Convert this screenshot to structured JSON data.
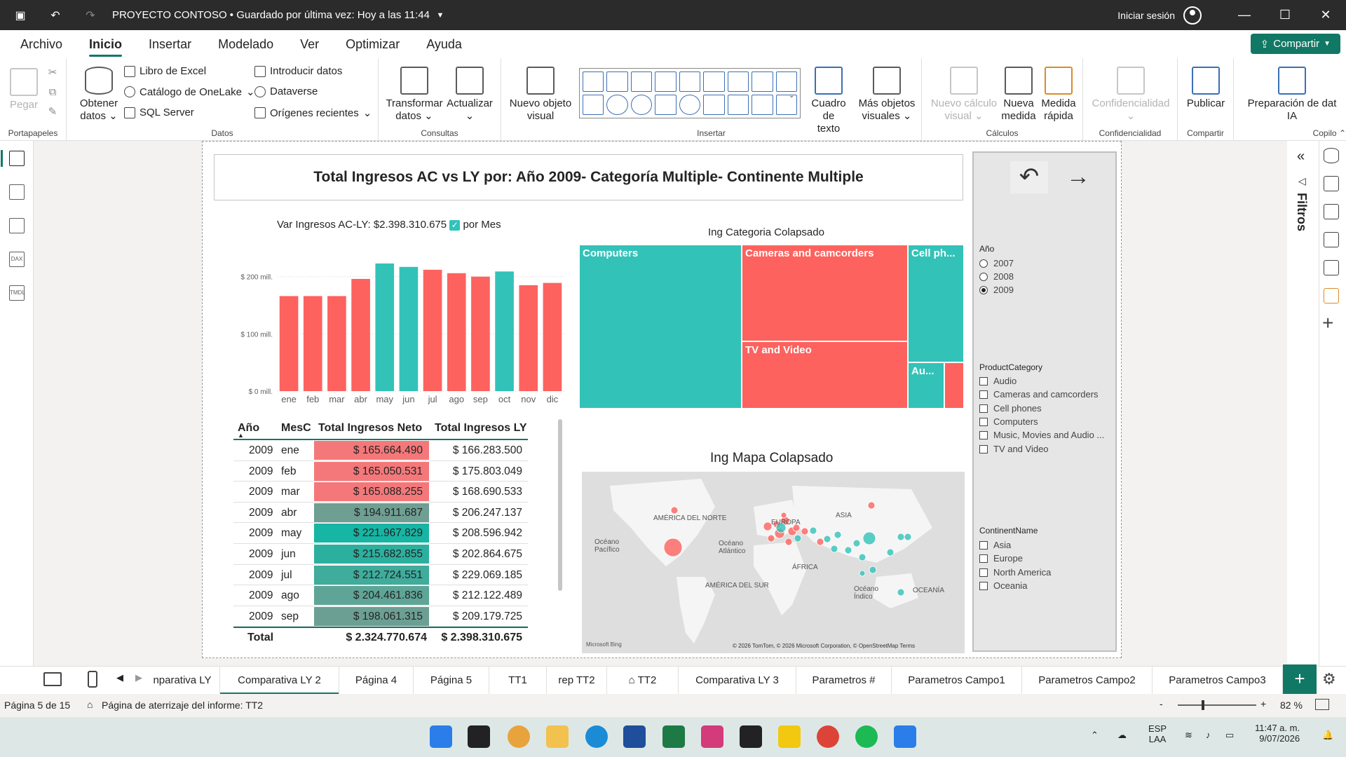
{
  "window": {
    "title": "PROYECTO CONTOSO • Guardado por última vez: Hoy a las 11:44",
    "signin": "Iniciar sesión"
  },
  "menu": {
    "items": [
      "Archivo",
      "Inicio",
      "Insertar",
      "Modelado",
      "Ver",
      "Optimizar",
      "Ayuda"
    ],
    "active": "Inicio",
    "share": "Compartir"
  },
  "ribbon": {
    "portapapeles": {
      "label": "Portapapeles",
      "paste": "Pegar"
    },
    "datos": {
      "label": "Datos",
      "get_data_1": "Obtener",
      "get_data_2": "datos",
      "excel": "Libro de Excel",
      "onelake": "Catálogo de OneLake",
      "sql": "SQL Server",
      "enter_data": "Introducir datos",
      "dataverse": "Dataverse",
      "recent": "Orígenes recientes"
    },
    "consultas": {
      "label": "Consultas",
      "transform_1": "Transformar",
      "transform_2": "datos",
      "refresh": "Actualizar"
    },
    "insertar": {
      "label": "Insertar",
      "new_visual_1": "Nuevo objeto",
      "new_visual_2": "visual",
      "textbox_1": "Cuadro de",
      "textbox_2": "texto",
      "more_1": "Más objetos",
      "more_2": "visuales"
    },
    "calculos": {
      "label": "Cálculos",
      "new_calc_1": "Nuevo cálculo",
      "new_calc_2": "visual",
      "new_measure_1": "Nueva",
      "new_measure_2": "medida",
      "quick_1": "Medida",
      "quick_2": "rápida"
    },
    "confidencialidad": {
      "label": "Confidencialidad",
      "btn": "Confidencialidad"
    },
    "compartir": {
      "label": "Compartir",
      "publish": "Publicar"
    },
    "copilot": {
      "label": "Copilo",
      "prep_1": "Preparación de dat",
      "prep_2": "IA"
    }
  },
  "report": {
    "title": "Total Ingresos AC vs LY por: Año 2009- Categoría Multiple- Continente Multiple",
    "bar_title_prefix": "Var Ingresos AC-LY: $2.398.310.675",
    "bar_title_suffix": "por Mes",
    "treemap_title": "Ing Categoria Colapsado",
    "map_title": "Ing Mapa Colapsado"
  },
  "chart_data": {
    "type": "bar",
    "categories": [
      "ene",
      "feb",
      "mar",
      "abr",
      "may",
      "jun",
      "jul",
      "ago",
      "sep",
      "oct",
      "nov",
      "dic"
    ],
    "values": [
      166,
      166,
      166,
      196,
      223,
      217,
      212,
      206,
      200,
      209,
      185,
      189
    ],
    "colors": [
      "#fd625e",
      "#fd625e",
      "#fd625e",
      "#fd625e",
      "#33c2b8",
      "#33c2b8",
      "#fd625e",
      "#fd625e",
      "#fd625e",
      "#33c2b8",
      "#fd625e",
      "#fd625e"
    ],
    "ylim": [
      0,
      240
    ],
    "yticks": [
      {
        "value": 0,
        "label": "$ 0 mill."
      },
      {
        "value": 100,
        "label": "$ 100 mill."
      },
      {
        "value": 200,
        "label": "$ 200 mill."
      }
    ],
    "xlabel": "",
    "ylabel": ""
  },
  "table": {
    "headers": [
      "Año",
      "MesC",
      "Total Ingresos Neto",
      "Total Ingresos LY"
    ],
    "rows": [
      {
        "year": "2009",
        "month": "ene",
        "neto": "$ 165.664.490",
        "ly": "$ 166.283.500",
        "bg": "#f4787a"
      },
      {
        "year": "2009",
        "month": "feb",
        "neto": "$ 165.050.531",
        "ly": "$ 175.803.049",
        "bg": "#f4787a"
      },
      {
        "year": "2009",
        "month": "mar",
        "neto": "$ 165.088.255",
        "ly": "$ 168.690.533",
        "bg": "#f4787a"
      },
      {
        "year": "2009",
        "month": "abr",
        "neto": "$ 194.911.687",
        "ly": "$ 206.247.137",
        "bg": "#6f9e93"
      },
      {
        "year": "2009",
        "month": "may",
        "neto": "$ 221.967.829",
        "ly": "$ 208.596.942",
        "bg": "#17b5a3"
      },
      {
        "year": "2009",
        "month": "jun",
        "neto": "$ 215.682.855",
        "ly": "$ 202.864.675",
        "bg": "#2bb09f"
      },
      {
        "year": "2009",
        "month": "jul",
        "neto": "$ 212.724.551",
        "ly": "$ 229.069.185",
        "bg": "#3fac9c"
      },
      {
        "year": "2009",
        "month": "ago",
        "neto": "$ 204.461.836",
        "ly": "$ 212.122.489",
        "bg": "#5ea597"
      },
      {
        "year": "2009",
        "month": "sep",
        "neto": "$ 198.061.315",
        "ly": "$ 209.179.725",
        "bg": "#6c9f93"
      }
    ],
    "total_label": "Total",
    "total_neto": "$ 2.324.770.674",
    "total_ly": "$ 2.398.310.675"
  },
  "treemap": {
    "cells": [
      "Computers",
      "Cameras and camcorders",
      "Cell ph...",
      "TV and Video",
      "Au..."
    ]
  },
  "map": {
    "labels": [
      "AMÉRICA DEL NORTE",
      "Océano Pacífico",
      "Océano Atlántico",
      "EUROPA",
      "ASIA",
      "ÁFRICA",
      "AMÉRICA DEL SUR",
      "Océano Índico",
      "OCEANÍA"
    ],
    "attribution": "© 2026 TomTom, © 2026 Microsoft Corporation, © OpenStreetMap  Terms",
    "logo": "Microsoft Bing"
  },
  "slicers": {
    "year": {
      "title": "Año",
      "options": [
        "2007",
        "2008",
        "2009"
      ],
      "selected": "2009"
    },
    "category": {
      "title": "ProductCategory",
      "options": [
        "Audio",
        "Cameras and camcorders",
        "Cell phones",
        "Computers",
        "Music, Movies and Audio ...",
        "TV and Video"
      ]
    },
    "continent": {
      "title": "ContinentName",
      "options": [
        "Asia",
        "Europe",
        "North America",
        "Oceania"
      ]
    }
  },
  "filters_label": "Filtros",
  "tabs": {
    "items": [
      "nparativa LY",
      "Comparativa LY 2",
      "Página 4",
      "Página 5",
      "TT1",
      "rep TT2",
      "TT2",
      "Comparativa LY 3",
      "Parametros #",
      "Parametros Campo1",
      "Parametros Campo2",
      "Parametros Campo3"
    ],
    "active": "Comparativa LY 2"
  },
  "status": {
    "page": "Página 5 de 15",
    "landing": "Página de aterrizaje del informe: TT2",
    "zoom": "82 %"
  },
  "taskbar": {
    "lang1": "ESP",
    "lang2": "LAA",
    "time": "11:47 a. m.",
    "date": "9/07/2026"
  },
  "colors": {
    "accent": "#117865",
    "positive": "#33c2b8",
    "negative": "#fd625e"
  }
}
